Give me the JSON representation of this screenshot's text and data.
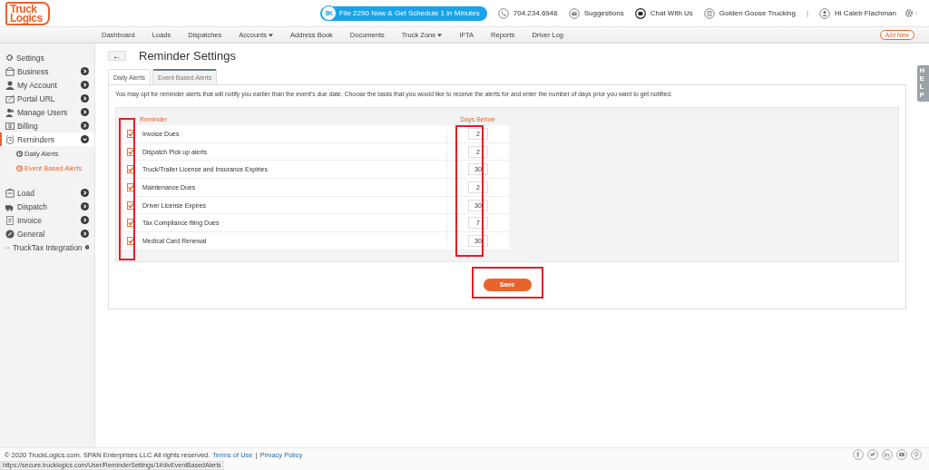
{
  "header": {
    "logo": {
      "line_1": "Truck",
      "line_2": "Logics"
    },
    "promo": {
      "badge": "8K",
      "label": "File 2290 Now & Get Schedule 1 in Minutes"
    },
    "links": [
      {
        "kind": "phone",
        "label": "704.234.6946"
      },
      {
        "kind": "mail",
        "label": "Suggestions"
      },
      {
        "kind": "chat",
        "label": "Chat With Us"
      },
      {
        "kind": "company",
        "label": "Golden Goose Trucking"
      }
    ],
    "separator": "|",
    "user": "Hi Caleb Flachman"
  },
  "nav": {
    "items": [
      {
        "label": "Dashboard",
        "has_menu": false
      },
      {
        "label": "Loads",
        "has_menu": false
      },
      {
        "label": "Dispatches",
        "has_menu": false
      },
      {
        "label": "Accounts",
        "has_menu": true
      },
      {
        "label": "Address Book",
        "has_menu": false
      },
      {
        "label": "Documents",
        "has_menu": false
      },
      {
        "label": "Truck Zone",
        "has_menu": true
      },
      {
        "label": "IFTA",
        "has_menu": false
      },
      {
        "label": "Reports",
        "has_menu": false
      },
      {
        "label": "Driver Log",
        "has_menu": false
      }
    ],
    "add_button": "Add New"
  },
  "sidebar": {
    "heading": "Settings",
    "groups": [
      [
        {
          "label": "Business",
          "expanded": false,
          "selected": false
        },
        {
          "label": "My Account",
          "expanded": false,
          "selected": false
        },
        {
          "label": "Portal URL",
          "expanded": false,
          "selected": false
        },
        {
          "label": "Manage Users",
          "expanded": false,
          "selected": false
        },
        {
          "label": "Billing",
          "expanded": false,
          "selected": false
        },
        {
          "label": "Reminders",
          "expanded": true,
          "selected": true,
          "children": [
            {
              "label": "Daily Alerts",
              "selected": false
            },
            {
              "label": "Event Based Alerts",
              "selected": true
            }
          ]
        }
      ],
      [
        {
          "label": "Load",
          "expanded": false,
          "selected": false
        },
        {
          "label": "Dispatch",
          "expanded": false,
          "selected": false
        },
        {
          "label": "Invoice",
          "expanded": false,
          "selected": false
        },
        {
          "label": "General",
          "expanded": false,
          "selected": false
        },
        {
          "label": "TruckTax Integration",
          "expanded": false,
          "selected": false
        }
      ]
    ]
  },
  "page": {
    "back": "←",
    "title": "Reminder Settings",
    "tabs": [
      {
        "label": "Daily Alerts",
        "selected": false
      },
      {
        "label": "Event Based Alerts",
        "selected": true
      }
    ],
    "description": "You may opt for reminder alerts that will notify you earlier than the event's due date. Choose the tasks that you would like to receive the alerts for and enter the number of days prior you want to get notified.",
    "table": {
      "columns": [
        "Reminder",
        "Days Before"
      ],
      "rows": [
        {
          "label": "Invoice Dues",
          "checked": true,
          "days": "2"
        },
        {
          "label": "Dispatch Pick up alerts",
          "checked": true,
          "days": "2"
        },
        {
          "label": "Truck/Trailer License and Insurance Expiries",
          "checked": true,
          "days": "30"
        },
        {
          "label": "Maintenance Dues",
          "checked": true,
          "days": "2"
        },
        {
          "label": "Driver License Expires",
          "checked": true,
          "days": "30"
        },
        {
          "label": "Tax Compliance filing Dues",
          "checked": true,
          "days": "7"
        },
        {
          "label": "Medical Card Renewal",
          "checked": true,
          "days": "30"
        }
      ]
    },
    "save": "Save"
  },
  "help_tab": "HELP",
  "footer": {
    "copyright": "© 2020 TruckLogics.com. SPAN Enterprises LLC All rights reserved.",
    "links": [
      "Terms of Use",
      "Privacy Policy"
    ],
    "link_separator": "|"
  },
  "status_url": "https://secure.trucklogics.com/User/ReminderSettings/1#divEventBasedAlerts"
}
